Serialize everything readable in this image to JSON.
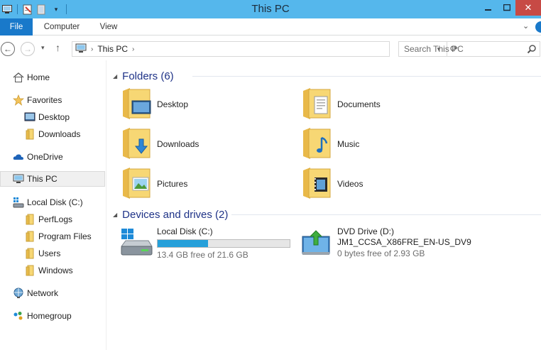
{
  "window": {
    "title": "This PC"
  },
  "ribbon": {
    "tabs": [
      "File",
      "Computer",
      "View"
    ]
  },
  "address": {
    "crumb": "This PC"
  },
  "search": {
    "placeholder": "Search This PC"
  },
  "sidebar": {
    "items": [
      {
        "label": "Home",
        "icon": "home-icon"
      },
      {
        "label": "Favorites",
        "icon": "star-icon"
      },
      {
        "label": "Desktop",
        "icon": "desktop-icon"
      },
      {
        "label": "Downloads",
        "icon": "folder-icon"
      },
      {
        "label": "OneDrive",
        "icon": "cloud-icon"
      },
      {
        "label": "This PC",
        "icon": "computer-icon",
        "selected": true
      },
      {
        "label": "Local Disk (C:)",
        "icon": "drive-icon"
      },
      {
        "label": "PerfLogs",
        "icon": "folder-icon"
      },
      {
        "label": "Program Files",
        "icon": "folder-icon"
      },
      {
        "label": "Users",
        "icon": "folder-icon"
      },
      {
        "label": "Windows",
        "icon": "folder-icon"
      },
      {
        "label": "Network",
        "icon": "network-icon"
      },
      {
        "label": "Homegroup",
        "icon": "homegroup-icon"
      }
    ]
  },
  "folders": {
    "header": "Folders (6)",
    "items": [
      {
        "label": "Desktop",
        "icon": "desktop-folder-icon"
      },
      {
        "label": "Documents",
        "icon": "documents-folder-icon"
      },
      {
        "label": "Downloads",
        "icon": "downloads-folder-icon"
      },
      {
        "label": "Music",
        "icon": "music-folder-icon"
      },
      {
        "label": "Pictures",
        "icon": "pictures-folder-icon"
      },
      {
        "label": "Videos",
        "icon": "videos-folder-icon"
      }
    ]
  },
  "devices": {
    "header": "Devices and drives (2)",
    "items": [
      {
        "name": "Local Disk (C:)",
        "free": "13.4 GB free of 21.6 GB",
        "used_fraction": 0.38,
        "icon": "hard-drive-icon"
      },
      {
        "name": "DVD Drive (D:)",
        "volume": "JM1_CCSA_X86FRE_EN-US_DV9",
        "free": "0 bytes free of 2.93 GB",
        "icon": "dvd-drive-icon"
      }
    ]
  },
  "colors": {
    "titlebar": "#55b7ec",
    "file_tab": "#1979ca",
    "header_text": "#1e3287",
    "progress": "#26a0da",
    "folder": "#f7d774"
  }
}
